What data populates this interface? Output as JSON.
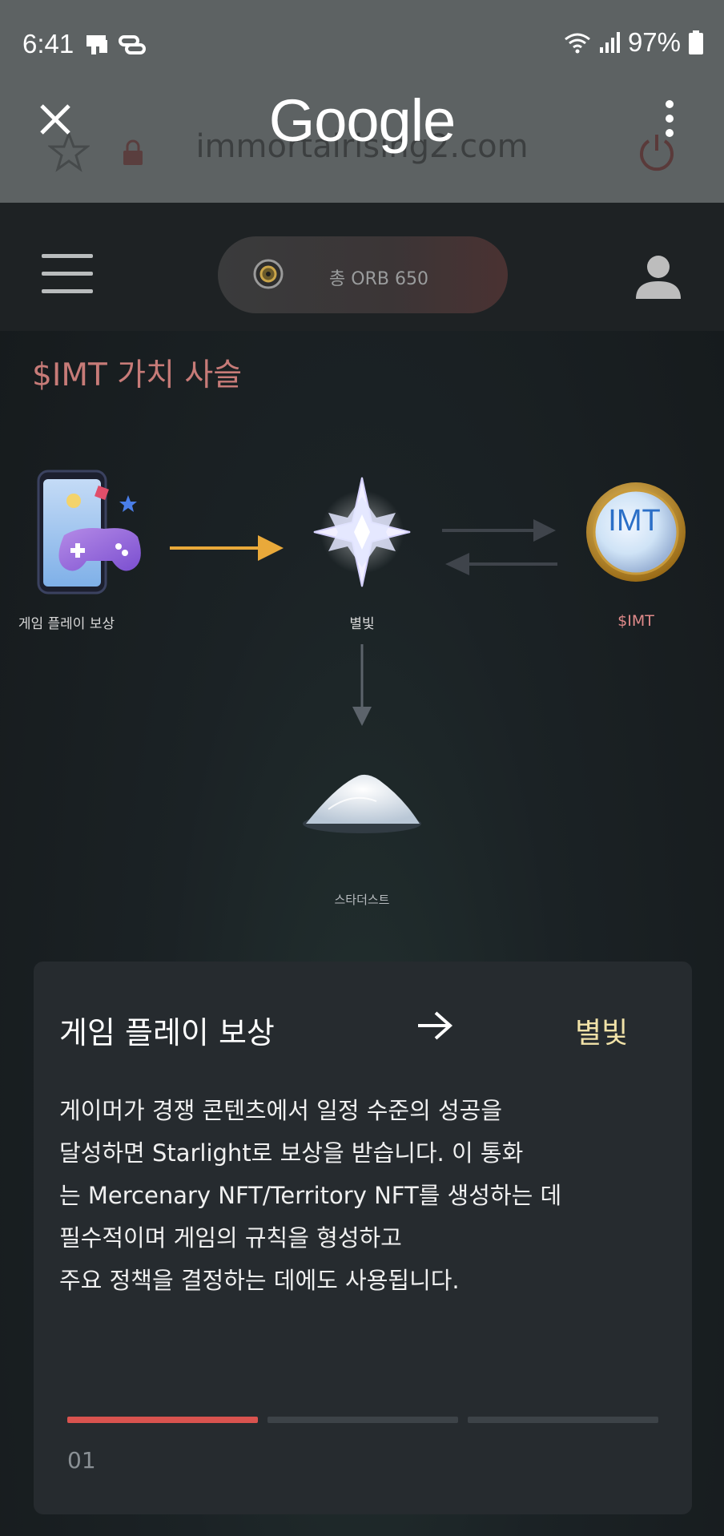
{
  "status_bar": {
    "time": "6:41",
    "battery_pct": "97%",
    "icons": [
      "notification-icon",
      "link-icon",
      "wifi-icon",
      "signal-icon",
      "battery-icon"
    ]
  },
  "browser": {
    "title": "Google",
    "ghost_url": "immortalrising2.com"
  },
  "header": {
    "orb_label": "총 ORB 650"
  },
  "section": {
    "title": "$IMT 가치 사슬"
  },
  "diagram": {
    "nodes": {
      "gameplay": "게임 플레이 보상",
      "starlight": "별빛",
      "imt": "$IMT",
      "imt_coin_text": "IMT",
      "stardust": "스타더스트"
    }
  },
  "card": {
    "from": "게임 플레이 보상",
    "to": "별빛",
    "description_lines": [
      "게이머가 경쟁 콘텐츠에서 일정 수준의 성공을",
      " 달성하면 Starlight로 보상을 받습니다. 이 통화",
      " 는 Mercenary NFT/Territory NFT를 생성하는 데",
      " 필수적이며 게임의 규칙을 형성하고",
      " 주요 정책을 결정하는 데에도 사용됩니다."
    ],
    "page": "01",
    "progress_segments": 3,
    "active_segment": 1
  },
  "colors": {
    "accent_red": "#d9534f",
    "title_red": "#c77b78",
    "card_to_yellow": "#f1e2a8",
    "imt_label": "#e08a8a",
    "arrow_gold": "#e9a93a"
  }
}
